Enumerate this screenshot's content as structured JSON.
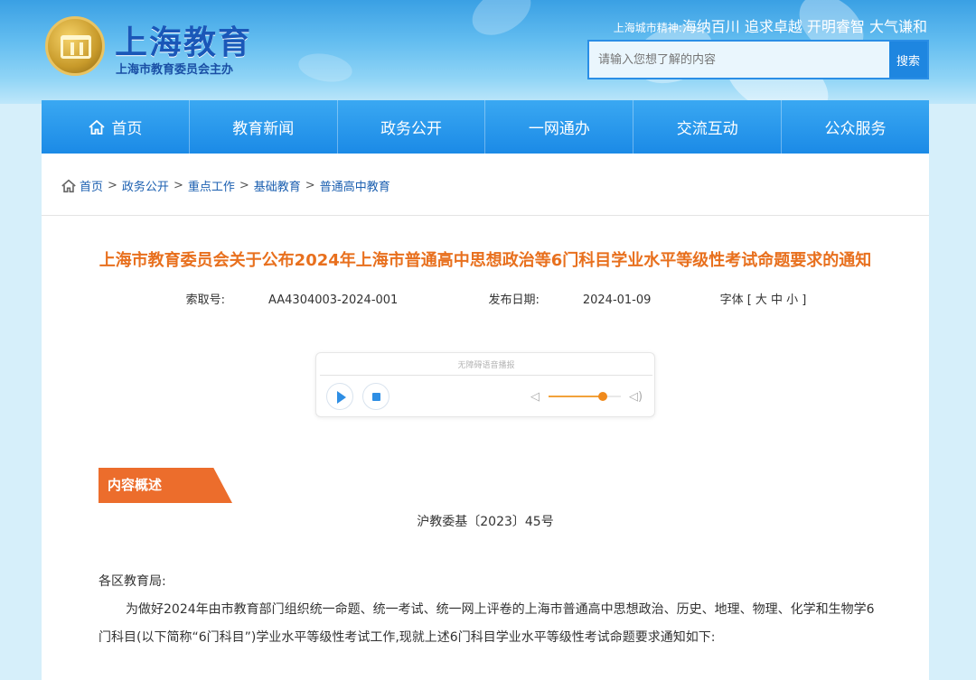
{
  "header": {
    "site_title": "上海教育",
    "site_subtitle": "上海市教育委员会主办",
    "spirit_label": "上海城市精神:",
    "spirit_text": "海纳百川 追求卓越 开明睿智 大气谦和",
    "search_placeholder": "请输入您想了解的内容",
    "search_button": "搜索"
  },
  "nav": {
    "items": [
      {
        "label": "首页"
      },
      {
        "label": "教育新闻"
      },
      {
        "label": "政务公开"
      },
      {
        "label": "一网通办"
      },
      {
        "label": "交流互动"
      },
      {
        "label": "公众服务"
      }
    ]
  },
  "breadcrumb": [
    "首页",
    "政务公开",
    "重点工作",
    "基础教育",
    "普通高中教育"
  ],
  "article": {
    "title": "上海市教育委员会关于公布2024年上海市普通高中思想政治等6门科目学业水平等级性考试命题要求的通知",
    "index_label": "索取号:",
    "index_value": "AA4304003-2024-001",
    "date_label": "发布日期:",
    "date_value": "2024-01-09",
    "font_label": "字体 [ 大 中 小 ]",
    "player_label": "无障碍语音播报",
    "player_volume": 0.75,
    "summary_tag": "内容概述",
    "doc_number": "沪教委基〔2023〕45号",
    "salutation": "各区教育局:",
    "paragraph": "为做好2024年由市教育部门组织统一命题、统一考试、统一网上评卷的上海市普通高中思想政治、历史、地理、物理、化学和生物学6门科目(以下简称“6门科目”)学业水平等级性考试工作,现就上述6门科目学业水平等级性考试命题要求通知如下:"
  }
}
